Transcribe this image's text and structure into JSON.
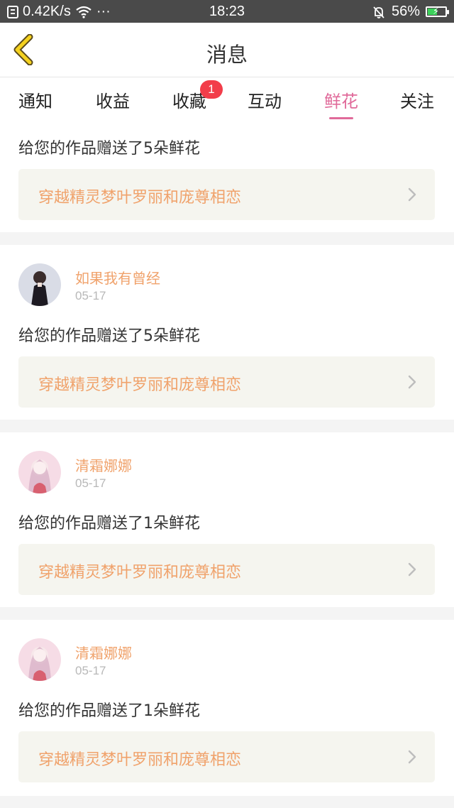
{
  "status_bar": {
    "network_speed": "0.42K/s",
    "more": "···",
    "time": "18:23",
    "battery_percent": "56%",
    "battery_level": 0.56
  },
  "header": {
    "title": "消息",
    "back_icon": "chevron-left-icon"
  },
  "tabs": [
    {
      "label": "通知",
      "active": false
    },
    {
      "label": "收益",
      "active": false
    },
    {
      "label": "收藏",
      "active": false,
      "badge": "1"
    },
    {
      "label": "互动",
      "active": false
    },
    {
      "label": "鲜花",
      "active": true
    },
    {
      "label": "关注",
      "active": false
    }
  ],
  "colors": {
    "accent": "#e06a9a",
    "username": "#f0a26b",
    "badge": "#f23d4a",
    "link_bg": "#f5f5ef"
  },
  "messages": [
    {
      "text": "给您的作品赠送了5朵鲜花",
      "work_title": "穿越精灵梦叶罗丽和庞尊相恋"
    },
    {
      "username": "如果我有曾经",
      "date": "05-17",
      "avatar": "avatar-girl-dark-dress",
      "text": "给您的作品赠送了5朵鲜花",
      "work_title": "穿越精灵梦叶罗丽和庞尊相恋"
    },
    {
      "username": "清霜娜娜",
      "date": "05-17",
      "avatar": "avatar-anime-girl-pink",
      "text": "给您的作品赠送了1朵鲜花",
      "work_title": "穿越精灵梦叶罗丽和庞尊相恋"
    },
    {
      "username": "清霜娜娜",
      "date": "05-17",
      "avatar": "avatar-anime-girl-pink",
      "text": "给您的作品赠送了1朵鲜花",
      "work_title": "穿越精灵梦叶罗丽和庞尊相恋"
    }
  ]
}
